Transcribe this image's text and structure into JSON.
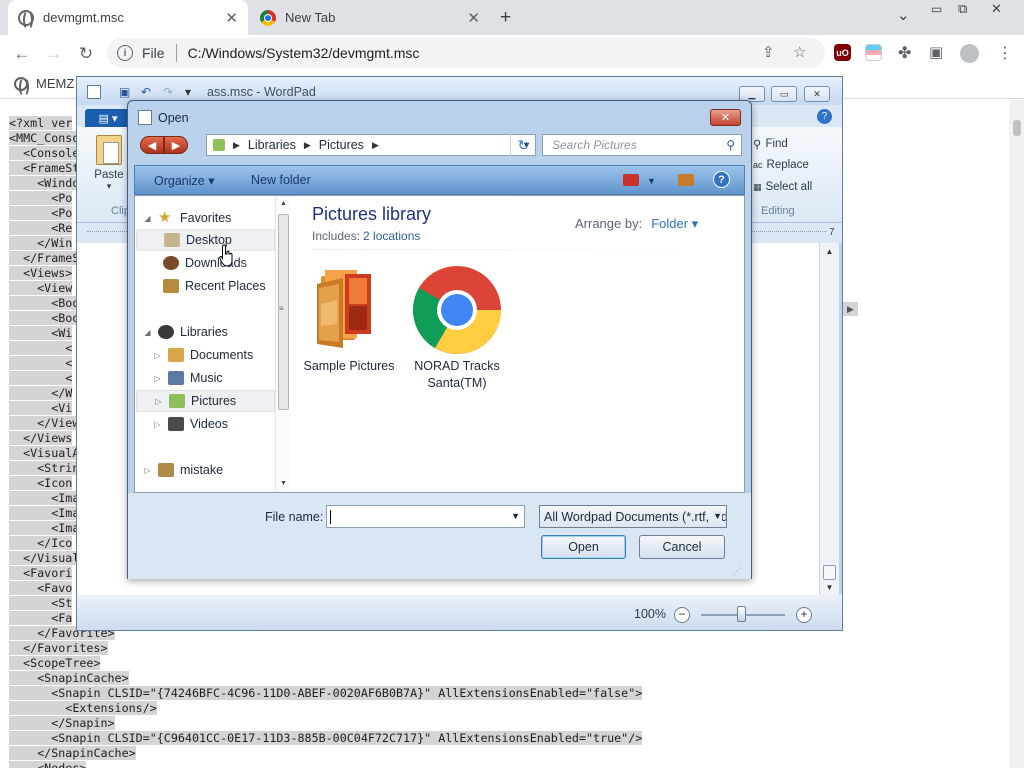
{
  "browser": {
    "tabs": [
      {
        "title": "devmgmt.msc",
        "active": true
      },
      {
        "title": "New Tab",
        "active": false
      }
    ],
    "new_tab_symbol": "+",
    "tab_menu_symbol": "⌄",
    "address": {
      "scheme": "File",
      "url": "C:/Windows/System32/devmgmt.msc"
    },
    "extensions": [
      "uBlock Origin",
      "ext-pride",
      "ext-puzzle",
      "side-panel",
      "profile"
    ],
    "bookmarks": [
      {
        "label": "MEMZ"
      }
    ]
  },
  "page": {
    "xml_lines": [
      "<?xml ver",
      "<MMC_Conso",
      "  <Console",
      "  <FrameSt",
      "    <Windo",
      "      <Po",
      "      <Po",
      "      <Re",
      "    </Win",
      "  </FrameS",
      "  <Views>",
      "    <View",
      "      <Boo",
      "      <Boo",
      "      <Wi",
      "        <",
      "        <",
      "        <",
      "      </W",
      "      <Vi",
      "    </View",
      "  </Views",
      "  <VisualA",
      "    <Strin",
      "    <Icon",
      "      <Ima",
      "      <Ima",
      "      <Ima",
      "    </Ico",
      "  </Visual",
      "  <Favori",
      "    <Favo",
      "      <St",
      "      <Fa",
      "    </Favorite>",
      "  </Favorites>",
      "  <ScopeTree>",
      "    <SnapinCache>",
      "      <Snapin CLSID=\"{74246BFC-4C96-11D0-ABEF-0020AF6B0B7A}\" AllExtensionsEnabled=\"false\">",
      "        <Extensions/>",
      "      </Snapin>",
      "      <Snapin CLSID=\"{C96401CC-0E17-11D3-885B-00C04F72C717}\" AllExtensionsEnabled=\"true\"/>",
      "    </SnapinCache>",
      "    <Nodes>"
    ]
  },
  "wordpad": {
    "title": "ass.msc - WordPad",
    "ribbon": {
      "paste_label": "Paste",
      "clipboard_group": "Clip",
      "find_label": "Find",
      "replace_label": "Replace",
      "select_all_label": "Select all",
      "editing_group": "Editing"
    },
    "ruler_end": "7",
    "zoom": "100%",
    "zoom_minus": "−",
    "zoom_plus": "+"
  },
  "dialog": {
    "title": "Open",
    "breadcrumb": [
      "Libraries",
      "Pictures"
    ],
    "search_placeholder": "Search Pictures",
    "organize_label": "Organize ▾",
    "new_folder_label": "New folder",
    "nav": {
      "favorites": "Favorites",
      "desktop": "Desktop",
      "downloads": "Downloads",
      "recent": "Recent Places",
      "libraries": "Libraries",
      "documents": "Documents",
      "music": "Music",
      "pictures": "Pictures",
      "videos": "Videos",
      "mistake": "mistake"
    },
    "library_title": "Pictures library",
    "includes_label": "Includes:",
    "includes_link": "2 locations",
    "arrange_label": "Arrange by:",
    "arrange_value": "Folder ▾",
    "items": [
      {
        "label": "Sample Pictures",
        "icon": "folder-icon"
      },
      {
        "label": "NORAD Tracks Santa(TM)",
        "icon": "chrome-icon"
      }
    ],
    "file_name_label": "File name:",
    "file_name_value": "",
    "file_type": "All Wordpad Documents (*.rtf, *.docx, *.odt, *.txt)",
    "open_label": "Open",
    "cancel_label": "Cancel"
  },
  "colors": {
    "chrome_tabstrip": "#dee1e6",
    "xml_highlight": "#d4d4d4",
    "dialog_frame": "#b9d1ea",
    "dialog_cmdbar": "#5f94cc",
    "library_title": "#1e3287",
    "link_blue": "#2f72c6"
  }
}
